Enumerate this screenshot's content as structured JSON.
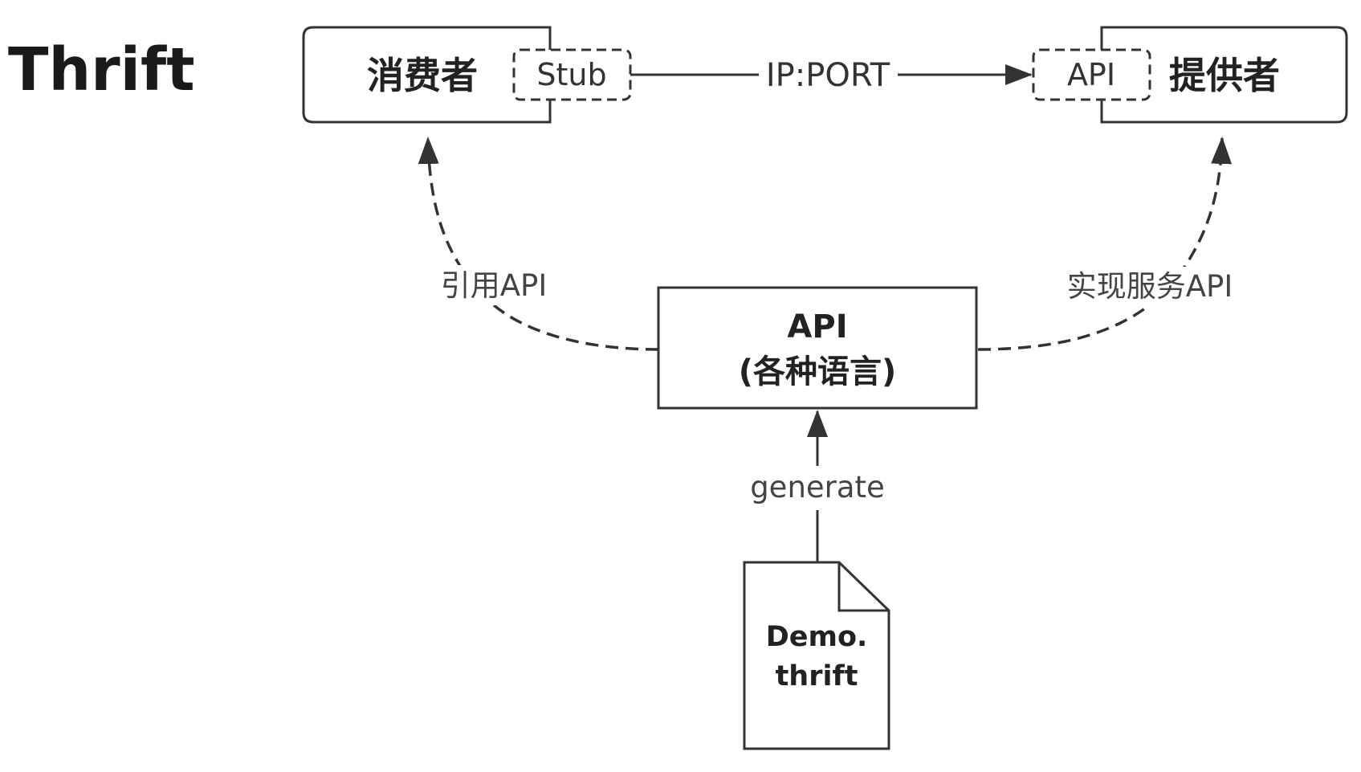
{
  "title": "Thrift",
  "consumer": {
    "label": "消费者",
    "stub_label": "Stub"
  },
  "provider": {
    "label": "提供者",
    "api_label": "API"
  },
  "connection": {
    "label": "IP:PORT"
  },
  "api_box": {
    "line1": "API",
    "line2": "(各种语言)"
  },
  "edges": {
    "consumer_ref": "引用API",
    "provider_impl": "实现服务API",
    "generate": "generate"
  },
  "document": {
    "line1": "Demo.",
    "line2": "thrift"
  },
  "colors": {
    "stroke": "#333333",
    "text": "#222222",
    "background": "#ffffff"
  }
}
